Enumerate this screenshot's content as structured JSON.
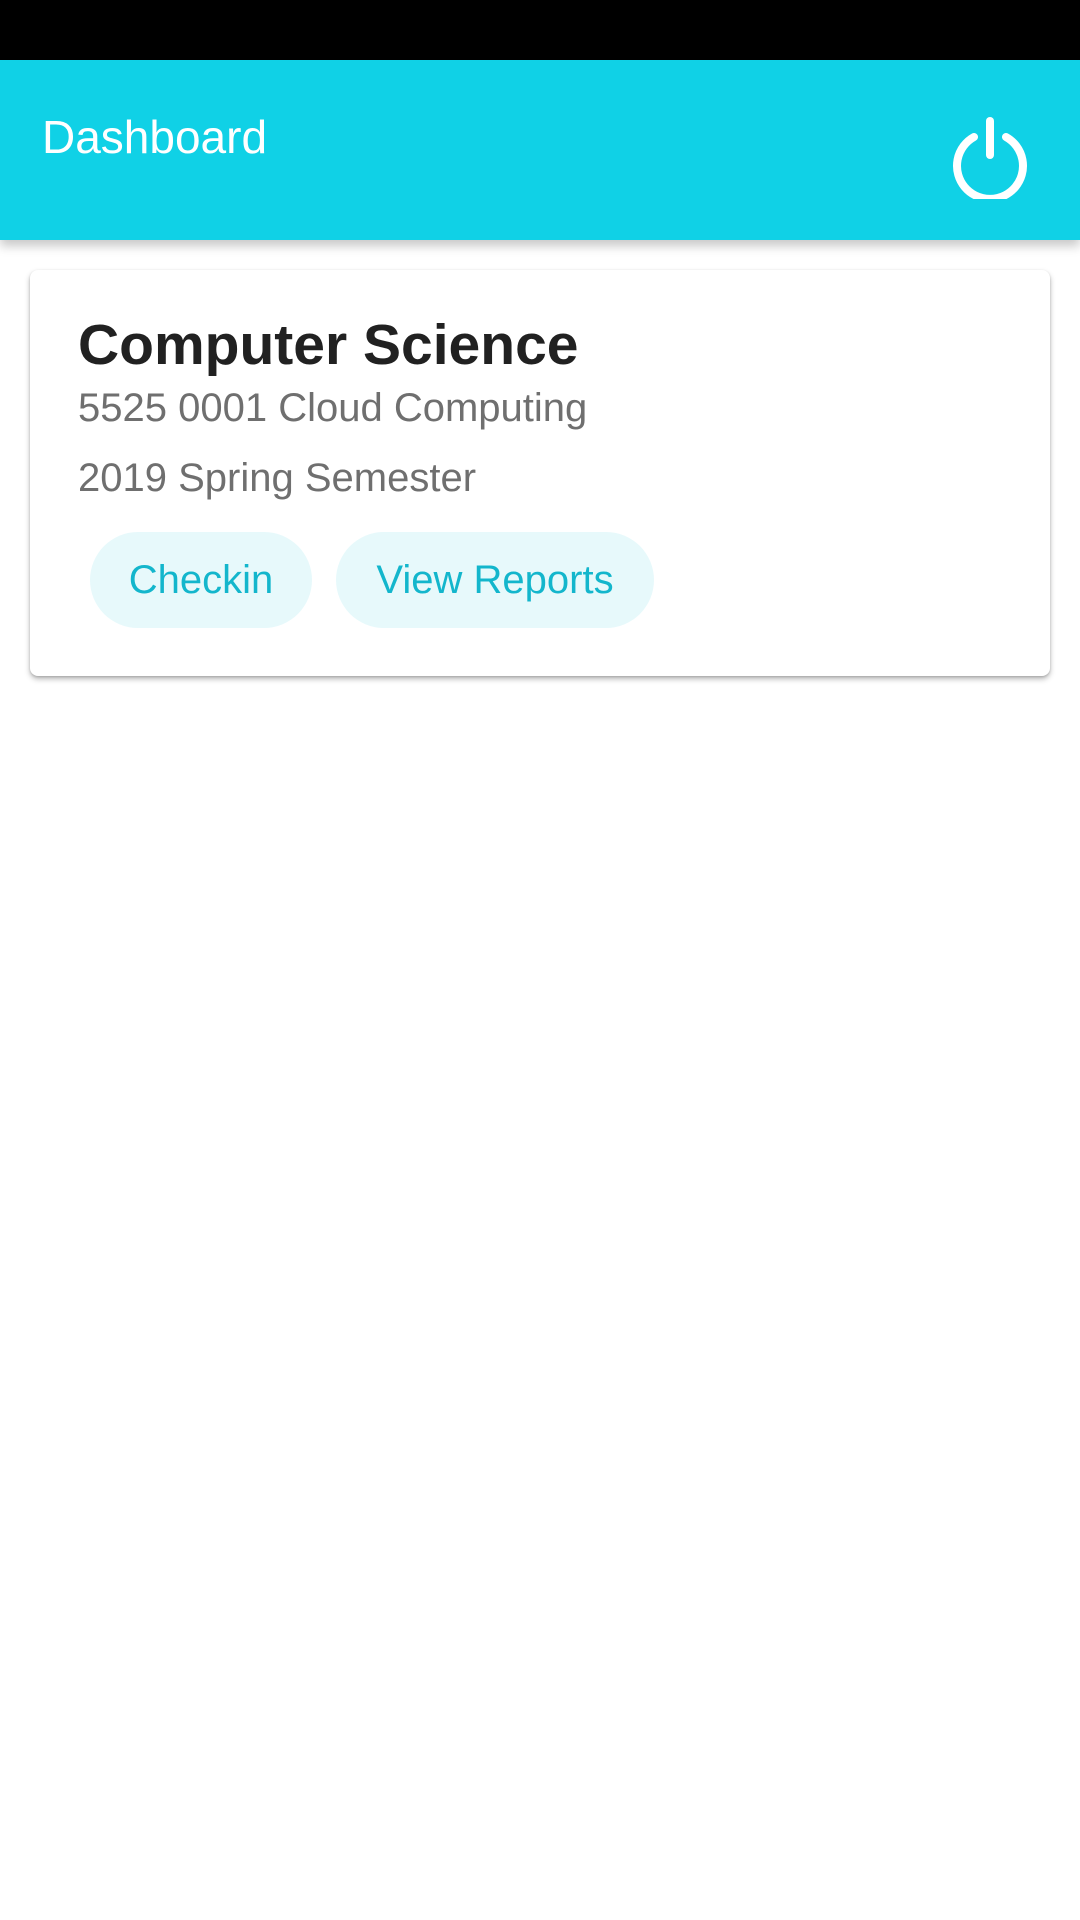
{
  "app_bar": {
    "title": "Dashboard",
    "power_icon": "power-icon",
    "color": "#10D1E6"
  },
  "card": {
    "title": "Computer Science",
    "course": "5525 0001 Cloud Computing",
    "semester": "2019 Spring Semester",
    "buttons": {
      "checkin_label": "Checkin",
      "reports_label": "View Reports"
    },
    "button_text_color": "#13B6CC",
    "button_bg_color": "#E7F9FB"
  }
}
